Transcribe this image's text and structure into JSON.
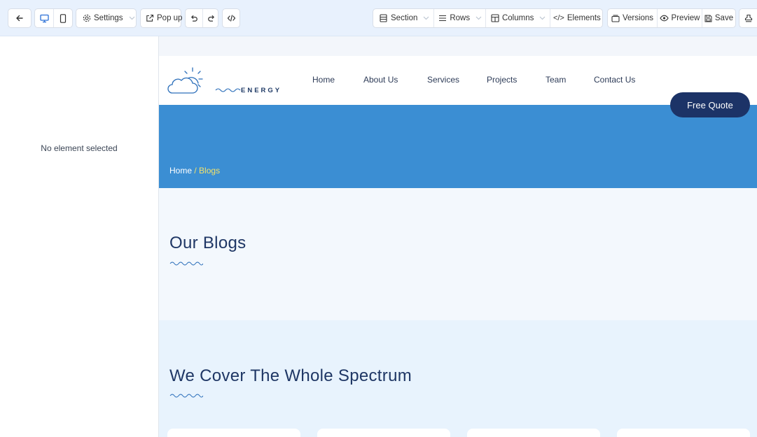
{
  "toolbar": {
    "back_icon": "arrow-left-icon",
    "desktop_icon": "desktop-icon",
    "mobile_icon": "mobile-icon",
    "settings_label": "Settings",
    "popup_label": "Pop up",
    "undo_icon": "undo-icon",
    "redo_icon": "redo-icon",
    "code_icon": "code-icon",
    "section_label": "Section",
    "rows_label": "Rows",
    "columns_label": "Columns",
    "elements_label": "Elements",
    "versions_label": "Versions",
    "preview_label": "Preview",
    "save_label": "Save",
    "extra_icon": "stamp-icon",
    "accent_color": "#2a6fd6"
  },
  "left_panel": {
    "empty_text": "No element selected"
  },
  "site": {
    "brand": "ENERGY",
    "nav": [
      "Home",
      "About Us",
      "Services",
      "Projects",
      "Team",
      "Contact Us"
    ],
    "cta": "Free Quote",
    "breadcrumb": {
      "home": "Home",
      "separator": "/",
      "current": "Blogs"
    },
    "section1_title": "Our Blogs",
    "section2_title": "We Cover The Whole Spectrum",
    "colors": {
      "hero": "#3b8ed3",
      "navy": "#1c3367",
      "crumb_current": "#f4e36a"
    }
  }
}
